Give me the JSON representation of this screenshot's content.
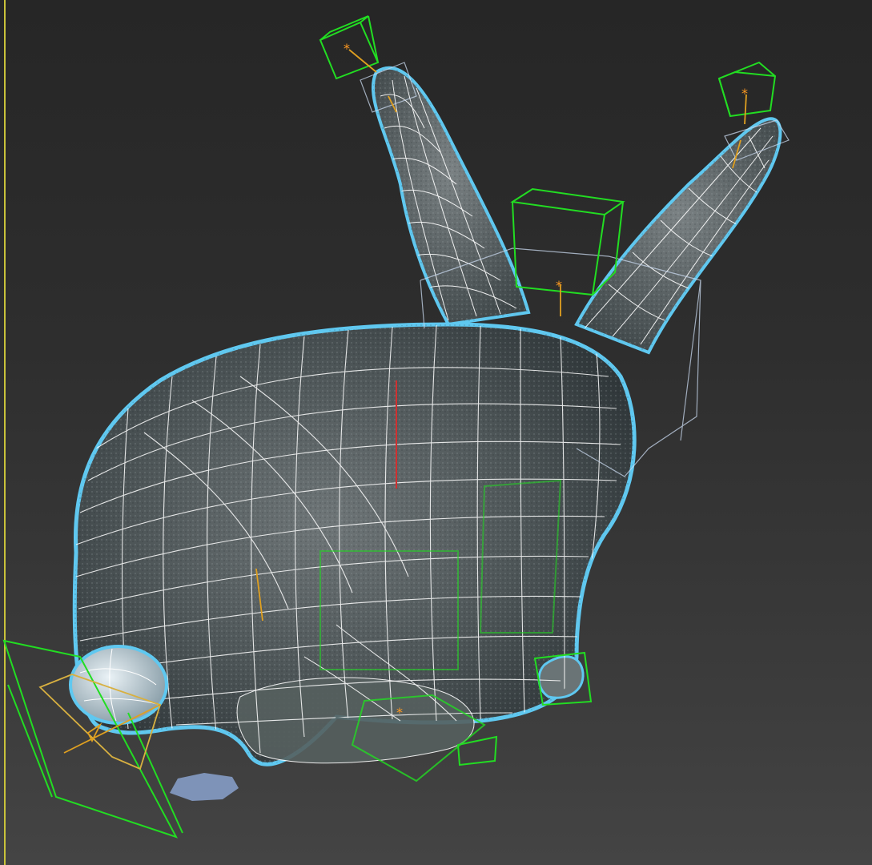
{
  "viewport": {
    "name": "3d-perspective-viewport",
    "shading": "textured-wireframe",
    "selection_outline_color": "#5fc8f0",
    "wire_color": "#ffffff",
    "helper_color": "#22dd22",
    "bone_color": "#e0a020",
    "frame_color": "#c9c23a",
    "background_top": "#262626",
    "background_bottom": "#444444"
  },
  "scene": {
    "object": "rabbit-mesh",
    "icons": [
      "selection-outline",
      "control-box-icon",
      "bone-icon",
      "bounding-box"
    ]
  }
}
